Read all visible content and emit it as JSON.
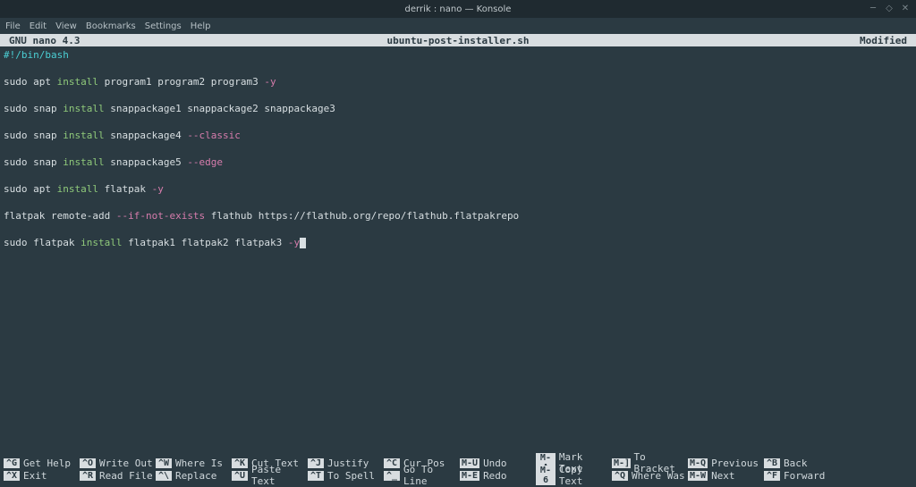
{
  "window": {
    "title": "derrik : nano — Konsole"
  },
  "menubar": [
    "File",
    "Edit",
    "View",
    "Bookmarks",
    "Settings",
    "Help"
  ],
  "nano_header": {
    "version": "GNU nano 4.3",
    "filename": "ubuntu-post-installer.sh",
    "status": "Modified"
  },
  "editor_lines": [
    [
      {
        "t": "#!/bin/bash",
        "c": "c-cyan"
      }
    ],
    [],
    [
      {
        "t": "sudo apt ",
        "c": "c-white"
      },
      {
        "t": "install",
        "c": "c-green"
      },
      {
        "t": " program1 program2 program3 ",
        "c": "c-white"
      },
      {
        "t": "-y",
        "c": "c-pink"
      }
    ],
    [],
    [
      {
        "t": "sudo snap ",
        "c": "c-white"
      },
      {
        "t": "install",
        "c": "c-green"
      },
      {
        "t": " snappackage1 snappackage2 snappackage3",
        "c": "c-white"
      }
    ],
    [],
    [
      {
        "t": "sudo snap ",
        "c": "c-white"
      },
      {
        "t": "install",
        "c": "c-green"
      },
      {
        "t": " snappackage4 ",
        "c": "c-white"
      },
      {
        "t": "--classic",
        "c": "c-pink"
      }
    ],
    [],
    [
      {
        "t": "sudo snap ",
        "c": "c-white"
      },
      {
        "t": "install",
        "c": "c-green"
      },
      {
        "t": " snappackage5 ",
        "c": "c-white"
      },
      {
        "t": "--edge",
        "c": "c-pink"
      }
    ],
    [],
    [
      {
        "t": "sudo apt ",
        "c": "c-white"
      },
      {
        "t": "install",
        "c": "c-green"
      },
      {
        "t": " flatpak ",
        "c": "c-white"
      },
      {
        "t": "-y",
        "c": "c-pink"
      }
    ],
    [],
    [
      {
        "t": "flatpak remote-add ",
        "c": "c-white"
      },
      {
        "t": "--if-not-exists",
        "c": "c-pink"
      },
      {
        "t": " flathub https://flathub.org/repo/flathub.flatpakrepo",
        "c": "c-white"
      }
    ],
    [],
    [
      {
        "t": "sudo flatpak ",
        "c": "c-white"
      },
      {
        "t": "install",
        "c": "c-green"
      },
      {
        "t": " flatpak1 flatpak2 flatpak3 ",
        "c": "c-white"
      },
      {
        "t": "-y",
        "c": "c-pink"
      },
      {
        "cursor": true
      }
    ]
  ],
  "shortcuts_row1": [
    {
      "key": "^G",
      "label": "Get Help"
    },
    {
      "key": "^O",
      "label": "Write Out"
    },
    {
      "key": "^W",
      "label": "Where Is"
    },
    {
      "key": "^K",
      "label": "Cut Text"
    },
    {
      "key": "^J",
      "label": "Justify"
    },
    {
      "key": "^C",
      "label": "Cur Pos"
    },
    {
      "key": "M-U",
      "label": "Undo"
    },
    {
      "key": "M-A",
      "label": "Mark Text"
    },
    {
      "key": "M-]",
      "label": "To Bracket"
    },
    {
      "key": "M-Q",
      "label": "Previous"
    },
    {
      "key": "^B",
      "label": "Back"
    }
  ],
  "shortcuts_row2": [
    {
      "key": "^X",
      "label": "Exit"
    },
    {
      "key": "^R",
      "label": "Read File"
    },
    {
      "key": "^\\",
      "label": "Replace"
    },
    {
      "key": "^U",
      "label": "Paste Text"
    },
    {
      "key": "^T",
      "label": "To Spell"
    },
    {
      "key": "^_",
      "label": "Go To Line"
    },
    {
      "key": "M-E",
      "label": "Redo"
    },
    {
      "key": "M-6",
      "label": "Copy Text"
    },
    {
      "key": "^Q",
      "label": "Where Was"
    },
    {
      "key": "M-W",
      "label": "Next"
    },
    {
      "key": "^F",
      "label": "Forward"
    }
  ]
}
